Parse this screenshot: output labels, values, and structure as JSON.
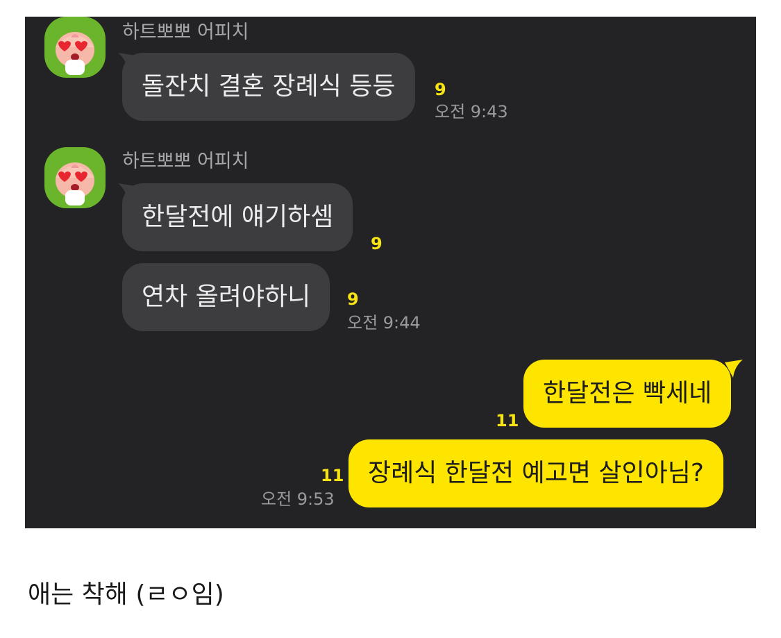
{
  "colors": {
    "chat_bg": "#232325",
    "incoming_bubble": "#3d3d40",
    "outgoing_bubble": "#fde500",
    "unread": "#f7e316",
    "avatar_bg": "#6ab52c"
  },
  "messages": [
    {
      "sender": "하트뽀뽀 어피치",
      "text": "돌잔치 결혼 장례식 등등",
      "unread": "9",
      "time": "오전 9:43"
    },
    {
      "sender": "하트뽀뽀 어피치",
      "text": "한달전에 얘기하셈",
      "unread": "9"
    },
    {
      "text": "연차 올려야하니",
      "unread": "9",
      "time": "오전 9:44"
    },
    {
      "text": "한달전은 빡세네",
      "unread": "11"
    },
    {
      "text": "장례식 한달전 예고면 살인아님?",
      "unread": "11",
      "time": "오전 9:53"
    }
  ],
  "avatar_icon": "apeach-heart-eyes-icon",
  "caption": "애는 착해 (ㄹㅇ임)"
}
